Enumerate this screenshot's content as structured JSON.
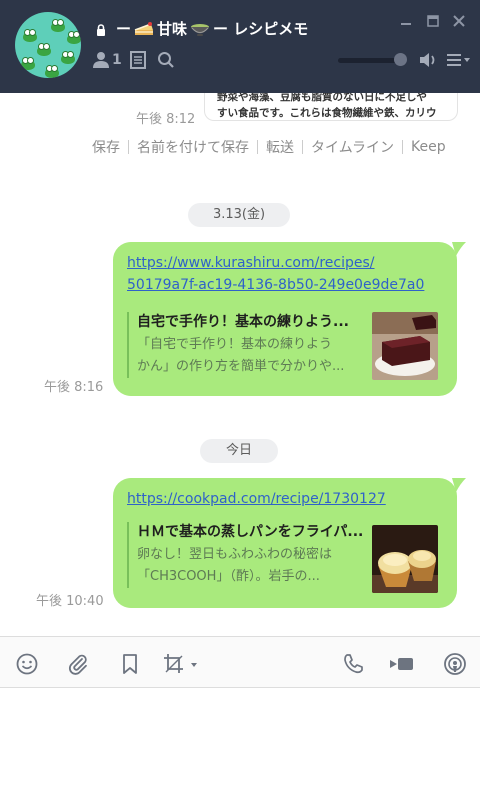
{
  "header": {
    "title_prefix": "ー",
    "title_middle": "甘味",
    "title_suffix": "ー レシピメモ",
    "member_count": "1",
    "title_icons": [
      "lock-icon",
      "cake-emoji-icon",
      "bowl-emoji-icon"
    ],
    "window_controls": [
      "minimize-icon",
      "maximize-icon",
      "close-icon"
    ],
    "tools": [
      "member-icon",
      "notes-icon",
      "search-icon",
      "volume-slider",
      "speaker-icon",
      "menu-icon"
    ],
    "volume_level": 0.9
  },
  "previous_message": {
    "card_line1": "野菜や海藻、豆腐も脂質のない日に不足しや",
    "card_line2": "すい食品です。これらは食物繊維や鉄、カリウ",
    "time": "午後 8:12"
  },
  "actions": [
    "保存",
    "名前を付けて保存",
    "転送",
    "タイムライン",
    "Keep"
  ],
  "messages": [
    {
      "date_label": "3.13(金)",
      "link_line1": "https://www.kurashiru.com/recipes/",
      "link_line2": "50179a7f-ac19-4136-8b50-249e0e9de7a0",
      "preview_title": "自宅で手作り！基本の練りよう...",
      "preview_desc1": "「自宅で手作り！基本の練りよう",
      "preview_desc2": "かん」の作り方を簡単で分かりや...",
      "time": "午後 8:16",
      "thumb_icon": "yokan-thumbnail"
    },
    {
      "date_label": "今日",
      "link_line1": "https://cookpad.com/recipe/1730127",
      "preview_title": "ＨＭで基本の蒸しパンをフライパ...",
      "preview_desc1": "卵なし！翌日もふわふわの秘密は",
      "preview_desc2": "「CH3COOH」（酢）。岩手の...",
      "time": "午後 10:40",
      "thumb_icon": "steamed-bun-thumbnail"
    }
  ],
  "toolbar": {
    "left_icons": [
      "emoji-icon",
      "attachment-icon",
      "bookmark-icon",
      "crop-screenshot-icon"
    ],
    "right_icons": [
      "phone-icon",
      "video-icon",
      "live-icon"
    ]
  },
  "colors": {
    "header_bg": "#2d3648",
    "bubble_bg": "#a9ea7d",
    "link": "#2f62c9",
    "timestamp": "#9a9a9a",
    "date_chip_bg": "#eeeff1",
    "preview_bar": "#78c05a"
  }
}
